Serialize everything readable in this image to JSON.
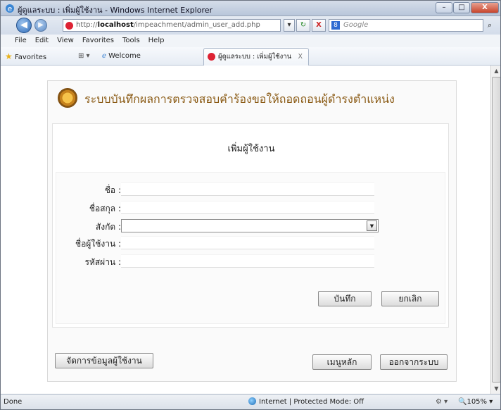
{
  "window": {
    "title": "ผู้ดูแลระบบ : เพิ่มผู้ใช้งาน - Windows Internet Explorer",
    "minimize": "–",
    "maximize": "□",
    "close": "X"
  },
  "addressbar": {
    "back": "◀",
    "forward": "▶",
    "url_prefix": "http://",
    "url_host": "localhost",
    "url_path": "/impeachment/admin_user_add.php",
    "refresh": "↻",
    "stop": "X",
    "search_placeholder": "Google",
    "search_badge": "8"
  },
  "menubar": [
    "File",
    "Edit",
    "View",
    "Favorites",
    "Tools",
    "Help"
  ],
  "favbar": {
    "favorites": "Favorites",
    "welcome": "Welcome",
    "tab_label": "ผู้ดูแลระบบ : เพิ่มผู้ใช้งาน",
    "tab_close": "X"
  },
  "page": {
    "header_title": "ระบบบันทึกผลการตรวจสอบคำร้องขอให้ถอดถอนผู้ดำรงตำแหน่ง",
    "form_title": "เพิ่มผู้ใช้งาน",
    "fields": {
      "first_name": "ชื่อ :",
      "last_name": "ชื่อสกุล :",
      "affiliation": "สังกัด :",
      "username": "ชื่อผู้ใช้งาน :",
      "password": "รหัสผ่าน :"
    },
    "buttons": {
      "save": "บันทึก",
      "cancel": "ยกเลิก",
      "manage_users": "จัดการข้อมูลผู้ใช้งาน",
      "main_menu": "เมนูหลัก",
      "logout": "ออกจากระบบ"
    }
  },
  "statusbar": {
    "left": "Done",
    "zone": "Internet | Protected Mode: Off",
    "zoom": "105%"
  }
}
